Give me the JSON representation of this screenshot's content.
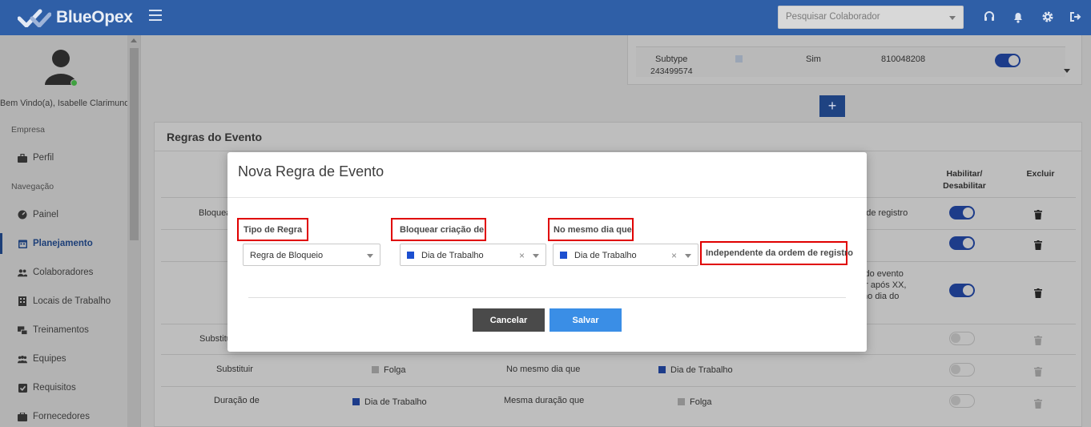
{
  "app": {
    "brand": "BlueOpex"
  },
  "header": {
    "search_placeholder": "Pesquisar Colaborador",
    "icons": [
      "headset-icon",
      "bell-icon",
      "gear-icon",
      "logout-icon"
    ]
  },
  "sidebar": {
    "welcome": "Bem Vindo(a), Isabelle Clarimundo",
    "section_company": "Empresa",
    "section_nav": "Navegação",
    "items": [
      {
        "label": "Perfil",
        "icon": "briefcase-icon"
      },
      {
        "label": "Painel",
        "icon": "dashboard-icon"
      },
      {
        "label": "Planejamento",
        "icon": "calendar-icon",
        "active": true
      },
      {
        "label": "Colaboradores",
        "icon": "users-icon"
      },
      {
        "label": "Locais de Trabalho",
        "icon": "building-icon"
      },
      {
        "label": "Treinamentos",
        "icon": "training-icon"
      },
      {
        "label": "Equipes",
        "icon": "team-icon"
      },
      {
        "label": "Requisitos",
        "icon": "checkbox-icon"
      },
      {
        "label": "Fornecedores",
        "icon": "supplier-icon"
      }
    ]
  },
  "subtype_row": {
    "name": "Subtype",
    "id": "243499574",
    "flag": "Sim",
    "code": "810048208",
    "enabled": true
  },
  "add_button": "+",
  "rules": {
    "title": "Regras do Evento",
    "col_toggle": "Habilitar/ Desabilitar",
    "col_delete": "Excluir",
    "rows": [
      {
        "a": "Bloquea",
        "d": "m de registro",
        "enabled": true
      },
      {
        "a": "",
        "d": "",
        "enabled": true
      },
      {
        "a": "",
        "d": "l do evento\nor após XX,\nmo dia do",
        "enabled": true
      },
      {
        "a": "Substitu",
        "enabled": false
      },
      {
        "a": "Substituir",
        "b": "Folga",
        "c": "No mesmo dia que",
        "d": "Dia de Trabalho",
        "enabled": false
      },
      {
        "a": "Duração de",
        "b": "Dia de Trabalho",
        "c": "Mesma duração que",
        "d": "Folga",
        "enabled": false
      }
    ]
  },
  "modal": {
    "title": "Nova Regra de Evento",
    "field1_label": "Tipo de Regra",
    "field1_value": "Regra de Bloqueio",
    "field2_label": "Bloquear criação de",
    "field2_value": "Dia de Trabalho",
    "field3_label": "No mesmo dia que",
    "field3_value": "Dia de Trabalho",
    "field4_text": "Independente da ordem de registro",
    "clear_glyph": "×",
    "cancel": "Cancelar",
    "save": "Salvar"
  },
  "colors": {
    "header": "#2f5fa7",
    "highlight": "#e00000",
    "save": "#3a8ee6",
    "cancel": "#4a4a4a"
  }
}
